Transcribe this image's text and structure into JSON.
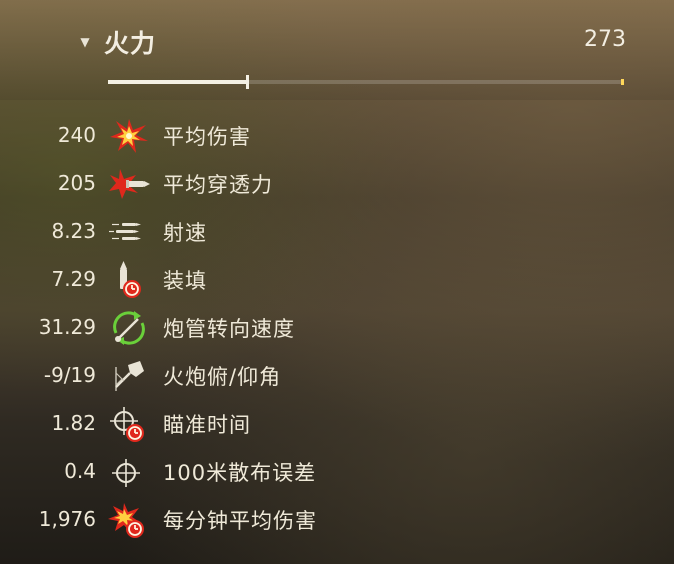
{
  "section": {
    "title": "火力",
    "total": "273",
    "progress": 0.27,
    "expanded_icon": "chevron-down-icon",
    "chevron_glyph": "▼"
  },
  "stats": [
    {
      "value": "240",
      "label": "平均伤害",
      "icon": "damage-burst-icon"
    },
    {
      "value": "205",
      "label": "平均穿透力",
      "icon": "penetration-shell-icon"
    },
    {
      "value": "8.23",
      "label": "射速",
      "icon": "rate-of-fire-icon"
    },
    {
      "value": "7.29",
      "label": "装填",
      "icon": "reload-shell-timer-icon"
    },
    {
      "value": "31.29",
      "label": "炮管转向速度",
      "icon": "gun-traverse-icon"
    },
    {
      "value": "-9/19",
      "label": "火炮俯/仰角",
      "icon": "gun-elevation-icon"
    },
    {
      "value": "1.82",
      "label": "瞄准时间",
      "icon": "aim-time-icon"
    },
    {
      "value": "0.4",
      "label": "100米散布误差",
      "icon": "crosshair-icon"
    },
    {
      "value": "1,976",
      "label": "每分钟平均伤害",
      "icon": "damage-per-minute-icon"
    }
  ],
  "colors": {
    "text": "#efe9d8",
    "accent_red": "#e0281c",
    "accent_yellow": "#ffd75a",
    "accent_green": "#6ad03a"
  }
}
